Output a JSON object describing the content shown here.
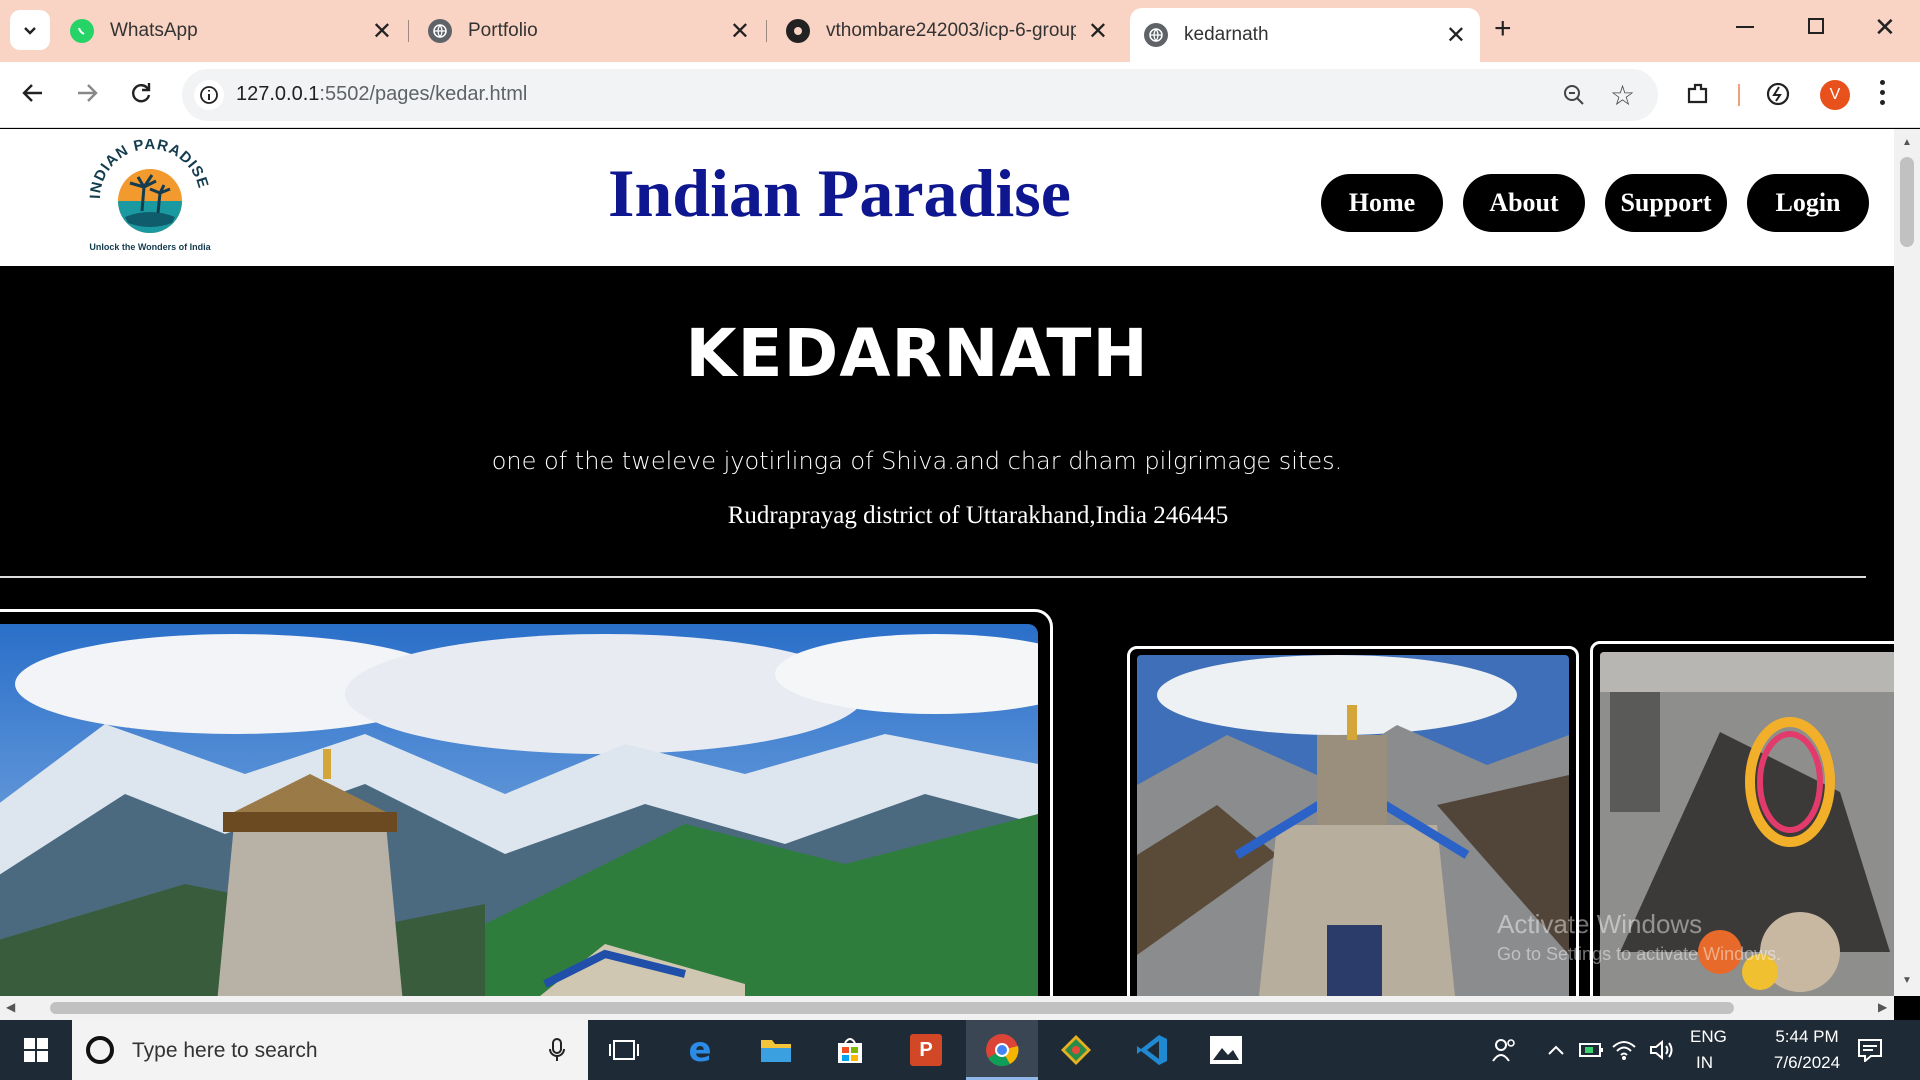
{
  "browser": {
    "tabs": [
      {
        "title": "WhatsApp",
        "icon": "whatsapp-icon"
      },
      {
        "title": "Portfolio",
        "icon": "globe-icon"
      },
      {
        "title": "vthombare242003/icp-6-group",
        "icon": "github-icon"
      },
      {
        "title": "kedarnath",
        "icon": "globe-icon",
        "active": true
      }
    ],
    "url_host": "127.0.0.1",
    "url_path": ":5502/pages/kedar.html",
    "profile_initial": "V"
  },
  "site": {
    "title": "Indian Paradise",
    "logo_arc_text": "INDIAN PARADISE",
    "logo_tagline": "Unlock the Wonders of India",
    "nav": [
      "Home",
      "About",
      "Support",
      "Login"
    ]
  },
  "hero": {
    "title": "KEDARNATH",
    "subtitle": "one of the tweleve jyotirlinga of Shiva.and char dham pilgrimage sites.",
    "location": "Rudraprayag district of Uttarakhand,India 246445"
  },
  "watermark": {
    "line1": "Activate Windows",
    "line2": "Go to Settings to activate Windows."
  },
  "taskbar": {
    "search_placeholder": "Type here to search",
    "lang_1": "ENG",
    "lang_2": "IN",
    "time": "5:44 PM",
    "date": "7/6/2024"
  }
}
